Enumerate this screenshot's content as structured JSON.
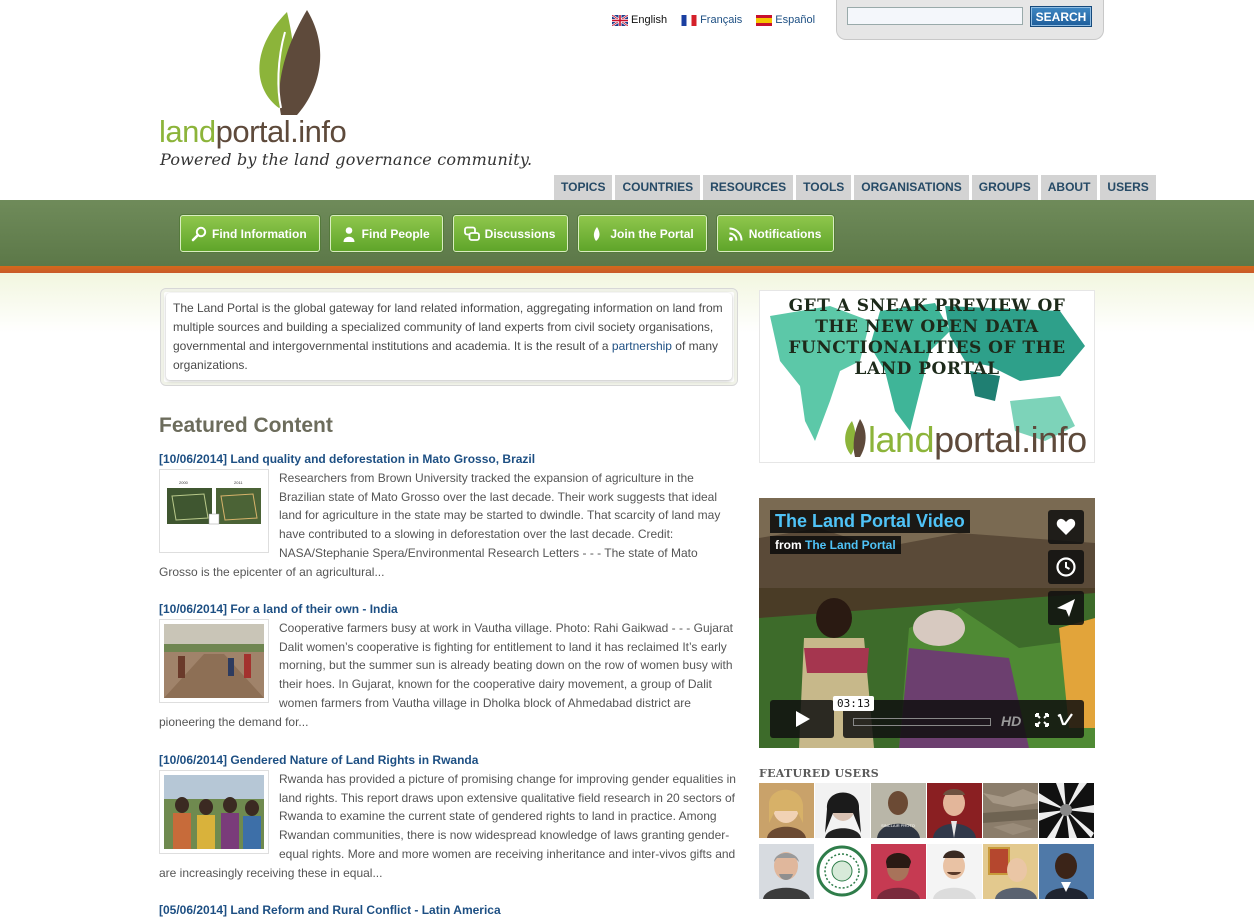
{
  "logo": {
    "name_part1": "land",
    "name_part2": "portal.info",
    "tagline": "Powered by the land governance community."
  },
  "languages": [
    {
      "label": "English",
      "flag": "uk-flag-icon"
    },
    {
      "label": "Français",
      "flag": "france-flag-icon"
    },
    {
      "label": "Español",
      "flag": "spain-flag-icon"
    }
  ],
  "search": {
    "value": "",
    "button_label": "SEARCH"
  },
  "main_nav": [
    "TOPICS",
    "COUNTRIES",
    "RESOURCES",
    "TOOLS",
    "ORGANISATIONS",
    "GROUPS",
    "ABOUT",
    "USERS"
  ],
  "quick_links": [
    {
      "label": "Find Information",
      "icon": "magnifier-icon"
    },
    {
      "label": "Find People",
      "icon": "person-icon"
    },
    {
      "label": "Discussions",
      "icon": "chat-icon"
    },
    {
      "label": "Join the Portal",
      "icon": "leaf-icon"
    },
    {
      "label": "Notifications",
      "icon": "rss-icon"
    }
  ],
  "intro": {
    "text_before": "The Land Portal is the global gateway for land related information, aggregating information on land from multiple sources and building a specialized community of land experts from civil society organisations, governmental and intergovernmental institutions and academia. It is the result of a ",
    "link": "partnership",
    "text_after": " of many organizations."
  },
  "featured": {
    "title": "Featured Content",
    "items": [
      {
        "title": "[10/06/2014] Land quality and deforestation in Mato Grosso, Brazil",
        "body": "Researchers from Brown University tracked the expansion of agriculture in the Brazilian state of Mato Grosso over the last decade. Their work suggests that ideal land for agriculture in the state may be started to dwindle. That scarcity of land may have contributed to a slowing in deforestation over the last decade. Credit: NASA/Stephanie Spera/Environmental Research Letters - - -  The state of Mato Grosso is the epicenter of an agricultural...",
        "thumb_labels": [
          "2000",
          "2011"
        ]
      },
      {
        "title": "[10/06/2014] For a land of their own - India",
        "body": "Cooperative farmers busy at work in Vautha village. Photo: Rahi Gaikwad - - -  Gujarat Dalit women’s cooperative is fighting for entitlement to land it has reclaimed It’s early morning, but the summer sun is already beating down on the row of women busy with their hoes. In Gujarat, known for the cooperative dairy movement, a group of Dalit women farmers from Vautha village in Dholka block of Ahmedabad district are pioneering the demand for..."
      },
      {
        "title": "[10/06/2014] Gendered Nature of Land Rights in Rwanda",
        "body": "Rwanda has provided a picture of promising change for improving gender equalities in land rights. This report draws upon extensive qualitative field research in 20 sectors of Rwanda to examine the current state of gendered rights to land in practice. Among Rwandan communities, there is now widespread knowledge of laws granting gender-equal rights. More and more women are receiving inheritance and inter-vivos gifts and are increasingly receiving these in equal..."
      },
      {
        "title": "[05/06/2014] Land Reform and Rural Conflict - Latin America",
        "body": ""
      }
    ]
  },
  "promo": {
    "heading": "Get a sneak preview of the new open data functionalities of the Land Portal",
    "logo_part1": "land",
    "logo_part2": "portal.info"
  },
  "video": {
    "title": "The Land Portal Video",
    "from_label": "from",
    "from_link": "The Land Portal",
    "time": "03:13",
    "hd_label": "HD"
  },
  "featured_users": {
    "title": "FEATURED USERS",
    "users": [
      {
        "name": "user-1",
        "label": ""
      },
      {
        "name": "user-2",
        "label": ""
      },
      {
        "name": "user-3",
        "label": "SINCLAIR PHOTO"
      },
      {
        "name": "user-4",
        "label": ""
      },
      {
        "name": "user-5",
        "label": ""
      },
      {
        "name": "user-6",
        "label": ""
      },
      {
        "name": "user-7",
        "label": ""
      },
      {
        "name": "user-8",
        "label": ""
      },
      {
        "name": "user-9",
        "label": ""
      },
      {
        "name": "user-10",
        "label": ""
      },
      {
        "name": "user-11",
        "label": ""
      },
      {
        "name": "user-12",
        "label": ""
      }
    ]
  },
  "colors": {
    "brand_green": "#8cb43a",
    "brand_brown": "#5e4a3b",
    "band_green": "#647f50",
    "accent_orange": "#d46a1a",
    "link_blue": "#1d4f83"
  }
}
